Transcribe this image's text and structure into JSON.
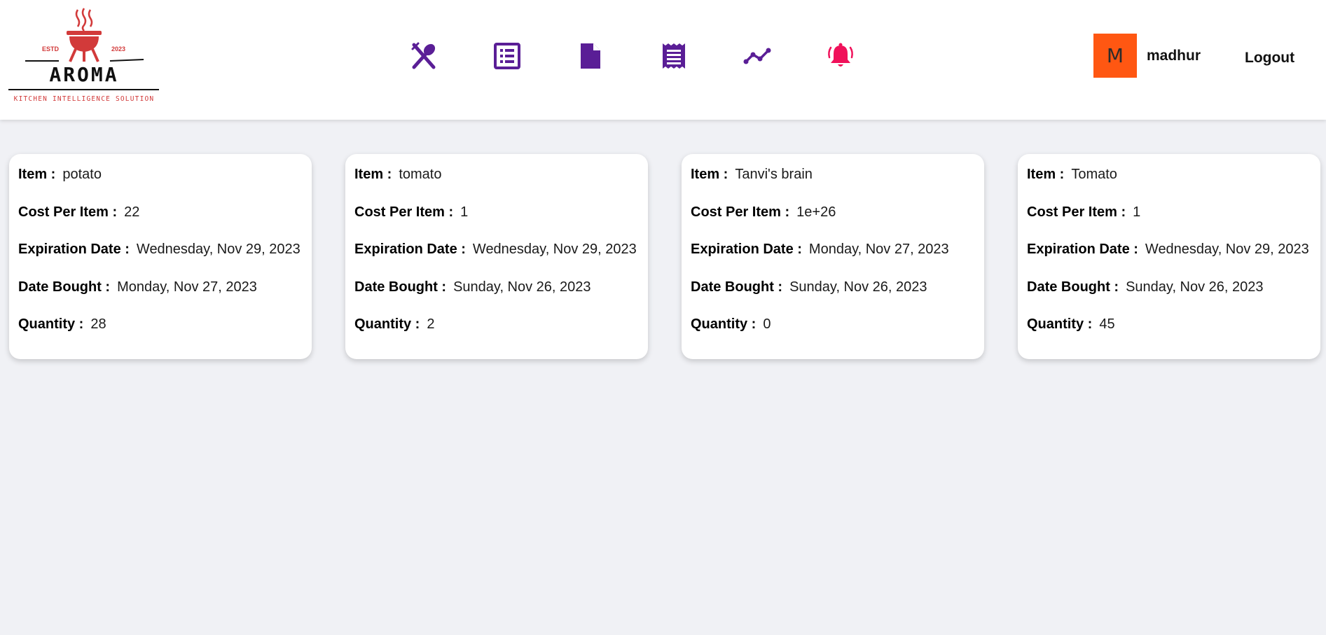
{
  "brand": {
    "name": "AROMA",
    "estd_label": "ESTD",
    "year": "2023",
    "tagline": "KITCHEN INTELLIGENCE SOLUTION",
    "accent_color": "#d23a3a"
  },
  "nav": {
    "icon_color": "#5a1e96",
    "alert_color": "#f0115a",
    "items": [
      {
        "icon": "utensils-icon"
      },
      {
        "icon": "list-icon"
      },
      {
        "icon": "document-icon"
      },
      {
        "icon": "receipt-icon"
      },
      {
        "icon": "trend-line-icon"
      },
      {
        "icon": "bell-icon"
      }
    ]
  },
  "user": {
    "initial": "M",
    "name": "madhur",
    "avatar_color": "#ff5712",
    "logout_label": "Logout"
  },
  "labels": {
    "item": "Item :",
    "cost": "Cost Per Item :",
    "expiration": "Expiration Date :",
    "bought": "Date Bought :",
    "quantity": "Quantity :"
  },
  "inventory": [
    {
      "item": "potato",
      "cost": "22",
      "expiration": "Wednesday, Nov 29, 2023",
      "bought": "Monday, Nov 27, 2023",
      "quantity": "28"
    },
    {
      "item": "tomato",
      "cost": "1",
      "expiration": "Wednesday, Nov 29, 2023",
      "bought": "Sunday, Nov 26, 2023",
      "quantity": "2"
    },
    {
      "item": "Tanvi's brain",
      "cost": "1e+26",
      "expiration": "Monday, Nov 27, 2023",
      "bought": "Sunday, Nov 26, 2023",
      "quantity": "0"
    },
    {
      "item": "Tomato",
      "cost": "1",
      "expiration": "Wednesday, Nov 29, 2023",
      "bought": "Sunday, Nov 26, 2023",
      "quantity": "45"
    }
  ]
}
